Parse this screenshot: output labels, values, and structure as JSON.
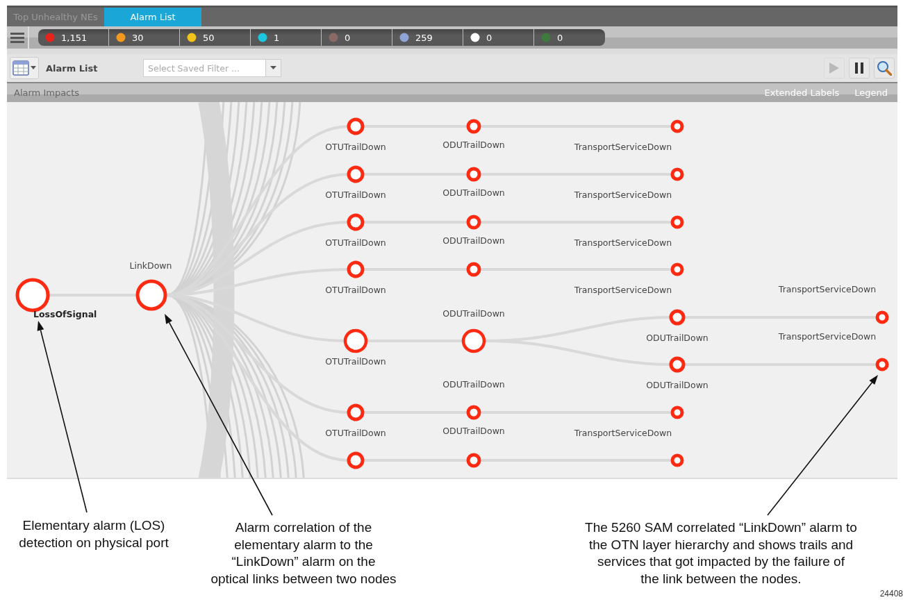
{
  "tabs": [
    {
      "label": "Top Unhealthy NEs",
      "selected": false
    },
    {
      "label": "Alarm List",
      "selected": true
    }
  ],
  "counters": [
    {
      "count": "1,151",
      "color": "#e8231c"
    },
    {
      "count": "30",
      "color": "#f39a1e"
    },
    {
      "count": "50",
      "color": "#f2c318"
    },
    {
      "count": "1",
      "color": "#1cc7e0"
    },
    {
      "count": "0",
      "color": "#8a6a64"
    },
    {
      "count": "259",
      "color": "#8ea4d6"
    },
    {
      "count": "0",
      "color": "#ffffff"
    },
    {
      "count": "0",
      "color": "#3f7a3f"
    }
  ],
  "toolbar": {
    "title": "Alarm List",
    "filter": {
      "placeholder": "Select Saved Filter ..."
    },
    "buttons": [
      {
        "kind": "play",
        "disabled": true
      },
      {
        "kind": "pause",
        "disabled": false
      },
      {
        "kind": "search",
        "disabled": false
      }
    ]
  },
  "impacts_bar": {
    "title": "Alarm Impacts",
    "links": [
      "Extended Labels",
      "Legend"
    ]
  },
  "graph": {
    "root": {
      "label": "LossOfSignal"
    },
    "correlated": {
      "label": "LinkDown"
    },
    "trails": [
      {
        "kind": "row",
        "otu": "OTUTrailDown",
        "odu": "ODUTrailDown",
        "service": "TransportServiceDown"
      },
      {
        "kind": "row",
        "otu": "OTUTrailDown",
        "odu": "ODUTrailDown",
        "service": "TransportServiceDown"
      },
      {
        "kind": "row",
        "otu": "OTUTrailDown",
        "odu": "ODUTrailDown",
        "service": "TransportServiceDown"
      },
      {
        "kind": "row",
        "otu": "OTUTrailDown",
        "odu": "ODUTrailDown",
        "service": "TransportServiceDown"
      },
      {
        "kind": "split",
        "otu": "OTUTrailDown",
        "odu": "ODUTrailDown",
        "branches": [
          {
            "odu": "ODUTrailDown",
            "service": "TransportServiceDown"
          },
          {
            "odu": "ODUTrailDown",
            "service": "TransportServiceDown"
          }
        ]
      },
      {
        "kind": "row",
        "otu": "OTUTrailDown",
        "odu": "ODUTrailDown",
        "service": "TransportServiceDown"
      },
      {
        "kind": "row"
      }
    ]
  },
  "callouts": [
    {
      "lines": [
        "Elementary alarm (LOS)",
        "detection on physical port"
      ]
    },
    {
      "lines": [
        "Alarm correlation of the",
        "elementary alarm to the",
        "“LinkDown” alarm on the",
        "optical links between two nodes"
      ]
    },
    {
      "lines": [
        "The 5260 SAM correlated “LinkDown” alarm to",
        "the OTN layer hierarchy and shows trails and",
        "services that got impacted by the failure of",
        "the link between the nodes."
      ]
    }
  ],
  "figure_number": "24408"
}
